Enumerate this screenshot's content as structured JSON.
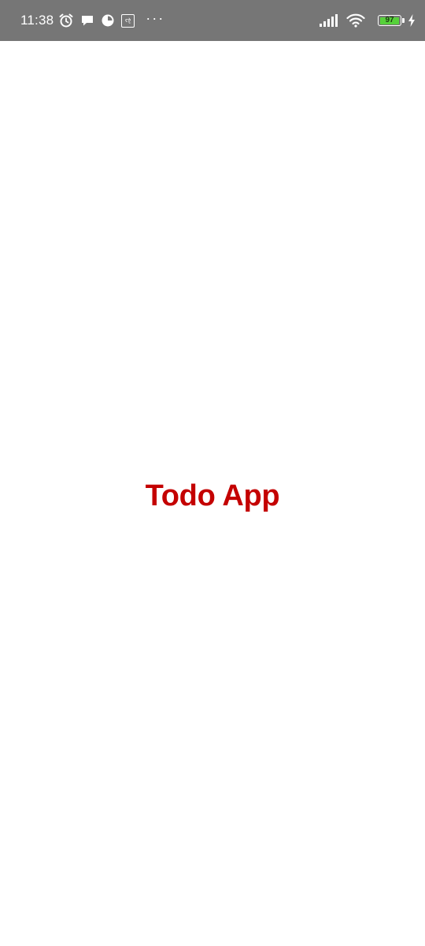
{
  "status_bar": {
    "time": "11:38",
    "left_icons": [
      "alarm-icon",
      "chat-bubble-icon",
      "data-saver-icon",
      "keyboard-icon"
    ],
    "kana_text": "ૡ",
    "more": "···",
    "right_icons": [
      "signal-icon",
      "wifi-icon",
      "battery-icon",
      "charging-icon"
    ],
    "battery_level": "97",
    "battery_fraction": 0.97,
    "battery_color": "#56d13a",
    "background": "#767676"
  },
  "splash": {
    "title": "Todo App",
    "title_color": "#c40000",
    "background": "#ffffff"
  }
}
